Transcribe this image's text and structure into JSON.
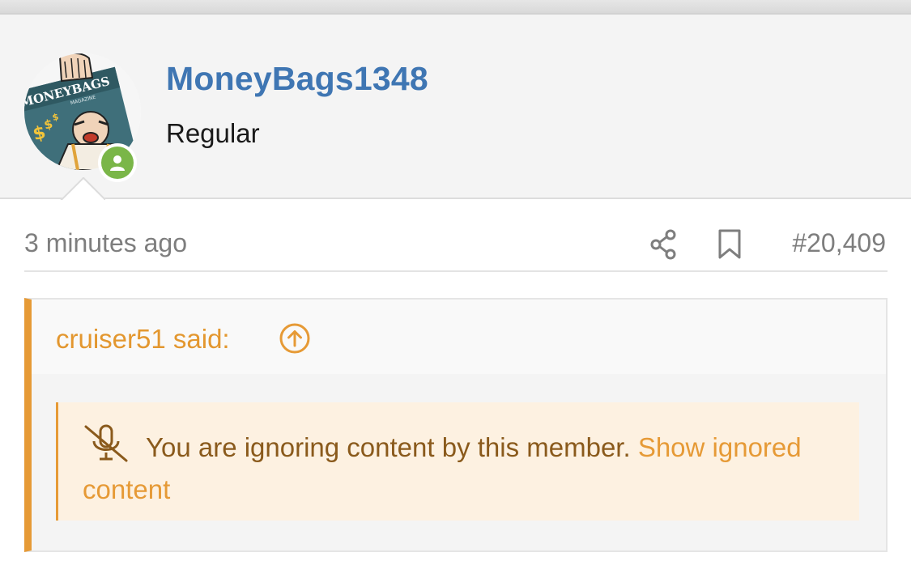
{
  "user": {
    "username": "MoneyBags1348",
    "title": "Regular",
    "avatar_text": "MONEYBAGS",
    "avatar_subtext": "MAGAZINE",
    "status": "online"
  },
  "post": {
    "time": "3 minutes ago",
    "number": "#20,409",
    "icons": [
      "share-icon",
      "bookmark-icon"
    ]
  },
  "quote": {
    "author_said": "cruiser51 said:",
    "ignored_message": "You are ignoring content by this member.",
    "show_link": "Show ignored content"
  },
  "colors": {
    "username": "#3f76b3",
    "quote_accent": "#e69a36",
    "online": "#7ab648"
  }
}
